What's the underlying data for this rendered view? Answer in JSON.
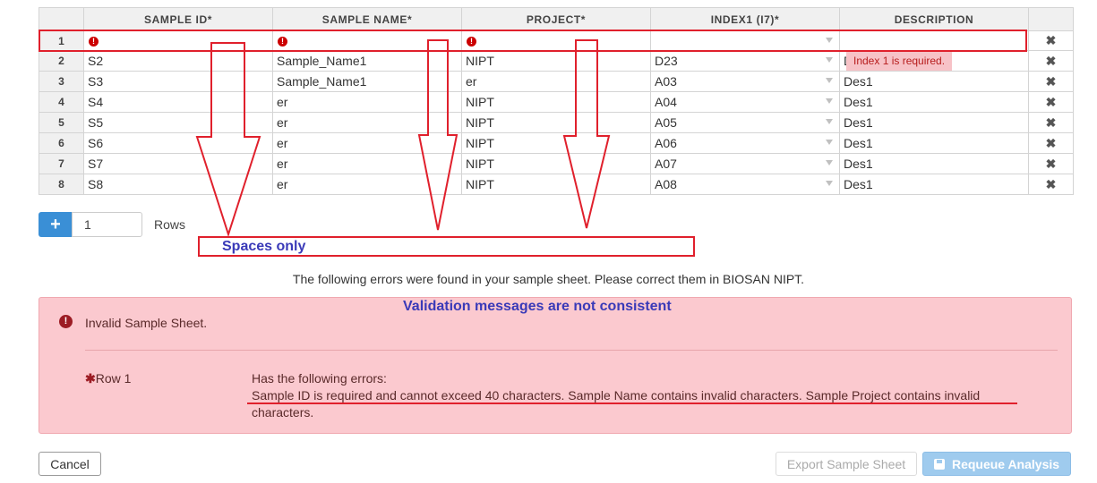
{
  "grid": {
    "headers": [
      "",
      "SAMPLE ID*",
      "SAMPLE NAME*",
      "PROJECT*",
      "INDEX1 (I7)*",
      "DESCRIPTION",
      ""
    ],
    "rows": [
      {
        "num": "1",
        "sample_id": "",
        "sample_name": "",
        "project": "",
        "index1": "",
        "description": ""
      },
      {
        "num": "2",
        "sample_id": "S2",
        "sample_name": "Sample_Name1",
        "project": "NIPT",
        "index1": "D23",
        "description": "D"
      },
      {
        "num": "3",
        "sample_id": "S3",
        "sample_name": "Sample_Name1",
        "project": "er",
        "index1": "A03",
        "description": "Des1"
      },
      {
        "num": "4",
        "sample_id": "S4",
        "sample_name": "er",
        "project": "NIPT",
        "index1": "A04",
        "description": "Des1"
      },
      {
        "num": "5",
        "sample_id": "S5",
        "sample_name": "er",
        "project": "NIPT",
        "index1": "A05",
        "description": "Des1"
      },
      {
        "num": "6",
        "sample_id": "S6",
        "sample_name": "er",
        "project": "NIPT",
        "index1": "A06",
        "description": "Des1"
      },
      {
        "num": "7",
        "sample_id": "S7",
        "sample_name": "er",
        "project": "NIPT",
        "index1": "A07",
        "description": "Des1"
      },
      {
        "num": "8",
        "sample_id": "S8",
        "sample_name": "er",
        "project": "NIPT",
        "index1": "A08",
        "description": "Des1"
      }
    ],
    "tooltip": "Index 1 is required.",
    "delete_glyph": "✖",
    "error_glyph": "!"
  },
  "add_rows": {
    "button": "+",
    "value": "1",
    "label": "Rows"
  },
  "annotations": {
    "spaces_only": "Spaces only",
    "validation": "Validation messages are not consistent",
    "highlight_color": "#e0202c",
    "text_color": "#3a3ab8"
  },
  "message": "The following errors were found in your sample sheet. Please correct them in BIOSAN NIPT.",
  "error_panel": {
    "icon": "!",
    "title": "Invalid Sample Sheet.",
    "row_star": "✱",
    "row_label": "Row 1",
    "heading": "Has the following errors:",
    "details": "Sample ID is required and cannot exceed 40 characters. Sample Name contains invalid characters. Sample Project contains invalid characters."
  },
  "footer": {
    "cancel": "Cancel",
    "export": "Export Sample Sheet",
    "requeue": "Requeue Analysis"
  }
}
